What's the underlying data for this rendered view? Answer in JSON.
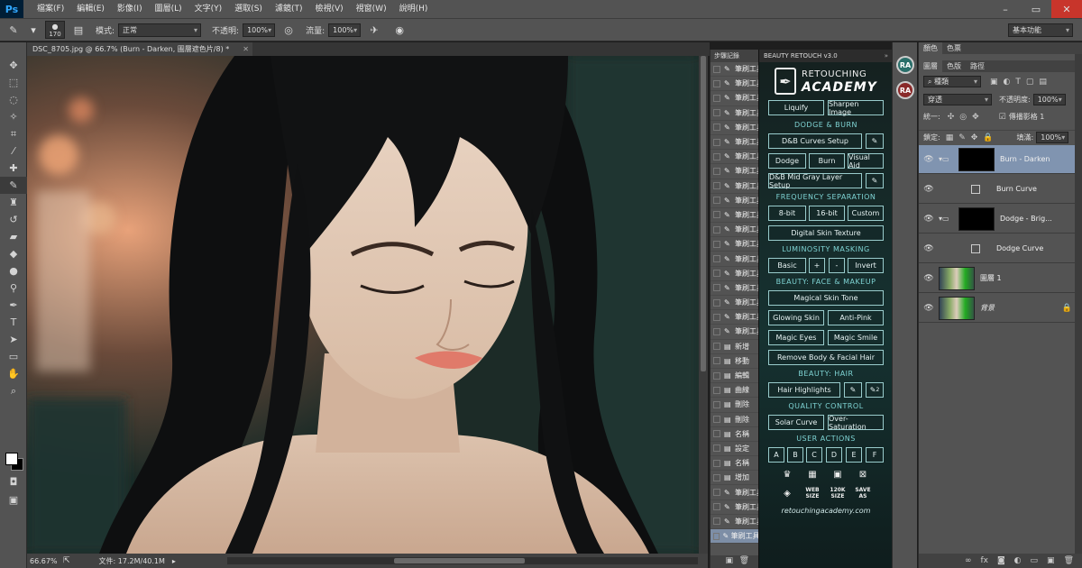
{
  "app": {
    "logo": "Ps",
    "menu": [
      "檔案(F)",
      "編輯(E)",
      "影像(I)",
      "圖層(L)",
      "文字(Y)",
      "選取(S)",
      "濾鏡(T)",
      "檢視(V)",
      "視窗(W)",
      "說明(H)"
    ]
  },
  "options": {
    "brush_size": "170",
    "mode_label": "模式:",
    "mode_value": "正常",
    "opacity_label": "不透明:",
    "opacity_value": "100%",
    "flow_label": "流量:",
    "flow_value": "100%",
    "workspace": "基本功能"
  },
  "document": {
    "tab_title": "DSC_8705.jpg @ 66.7% (Burn - Darken, 圖層遮色片/8) *",
    "zoom": "66.67%",
    "file_size": "文件: 17.2M/40.1M"
  },
  "history": {
    "tab": "步驟記錄",
    "items": [
      {
        "label": "筆刷工具",
        "type": "brush"
      },
      {
        "label": "筆刷工具",
        "type": "brush"
      },
      {
        "label": "筆刷工具",
        "type": "brush"
      },
      {
        "label": "筆刷工具",
        "type": "brush"
      },
      {
        "label": "筆刷工具",
        "type": "brush"
      },
      {
        "label": "筆刷工具",
        "type": "brush"
      },
      {
        "label": "筆刷工具",
        "type": "brush"
      },
      {
        "label": "筆刷工具",
        "type": "brush"
      },
      {
        "label": "筆刷工具",
        "type": "brush"
      },
      {
        "label": "筆刷工具",
        "type": "brush"
      },
      {
        "label": "筆刷工具",
        "type": "brush"
      },
      {
        "label": "筆刷工具",
        "type": "brush"
      },
      {
        "label": "筆刷工具",
        "type": "brush"
      },
      {
        "label": "筆刷工具",
        "type": "brush"
      },
      {
        "label": "筆刷工具",
        "type": "brush"
      },
      {
        "label": "筆刷工具",
        "type": "brush"
      },
      {
        "label": "筆刷工具",
        "type": "brush"
      },
      {
        "label": "筆刷工具",
        "type": "brush"
      },
      {
        "label": "筆刷工具",
        "type": "brush"
      },
      {
        "label": "新增",
        "type": "doc"
      },
      {
        "label": "移動",
        "type": "doc"
      },
      {
        "label": "編輯",
        "type": "doc"
      },
      {
        "label": "曲線",
        "type": "doc"
      },
      {
        "label": "刪除",
        "type": "doc"
      },
      {
        "label": "刪除",
        "type": "doc"
      },
      {
        "label": "名稱",
        "type": "doc"
      },
      {
        "label": "設定",
        "type": "doc"
      },
      {
        "label": "名稱",
        "type": "doc"
      },
      {
        "label": "增加",
        "type": "doc"
      },
      {
        "label": "筆刷工具",
        "type": "brush"
      },
      {
        "label": "筆刷工具",
        "type": "brush"
      },
      {
        "label": "筆刷工具",
        "type": "brush"
      },
      {
        "label": "筆刷工具",
        "type": "brush"
      }
    ]
  },
  "beauty": {
    "tab": "BEAUTY RETOUCH v3.0",
    "logo_line1": "RETOUCHING",
    "logo_line2": "ACADEMY",
    "liquify": "Liquify",
    "sharpen": "Sharpen Image",
    "h_dodge_burn": "DODGE & BURN",
    "db_curves": "D&B Curves Setup",
    "dodge": "Dodge",
    "burn": "Burn",
    "visual_aid": "Visual Aid",
    "db_mid_gray": "D&B Mid Gray Layer Setup",
    "h_freq": "FREQUENCY SEPARATION",
    "bit8": "8-bit",
    "bit16": "16-bit",
    "custom": "Custom",
    "digital_skin": "Digital Skin Texture",
    "h_lum": "LUMINOSITY MASKING",
    "basic": "Basic",
    "plus": "+",
    "minus": "-",
    "invert": "Invert",
    "h_face": "BEAUTY: FACE & MAKEUP",
    "magical_skin": "Magical Skin Tone",
    "glowing_skin": "Glowing Skin",
    "anti_pink": "Anti-Pink",
    "magic_eyes": "Magic Eyes",
    "magic_smile": "Magic Smile",
    "remove_hair": "Remove Body & Facial Hair",
    "h_hair": "BEAUTY: HAIR",
    "hair_highlights": "Hair Highlights",
    "brush2": "2",
    "h_qc": "QUALITY CONTROL",
    "solar_curve": "Solar Curve",
    "over_sat": "Over-Saturation",
    "h_user": "USER ACTIONS",
    "user_actions": [
      "A",
      "B",
      "C",
      "D",
      "E",
      "F"
    ],
    "web_size": "WEB SIZE",
    "size_120k": "120K SIZE",
    "save_as": "SAVE AS",
    "url": "retouchingacademy.com"
  },
  "dock": {
    "badge1": "RA",
    "badge2": "RA"
  },
  "panels": {
    "color_tabs": [
      "顏色",
      "色票"
    ],
    "layer_tabs": [
      "圖層",
      "色版",
      "路徑"
    ],
    "kind": "種類",
    "blend": "穿透",
    "opacity_label": "不透明度:",
    "opacity_value": "100%",
    "unify_label": "統一:",
    "propagate": "傳播影格 1",
    "lock_label": "鎖定:",
    "fill_label": "填滿:",
    "fill_value": "100%",
    "layers": [
      {
        "name": "Burn - Darken",
        "kind": "group"
      },
      {
        "name": "Burn Curve",
        "kind": "adjust"
      },
      {
        "name": "Dodge - Brig...",
        "kind": "group"
      },
      {
        "name": "Dodge Curve",
        "kind": "adjust"
      },
      {
        "name": "圖層 1",
        "kind": "photo"
      },
      {
        "name": "背景",
        "kind": "photo"
      }
    ]
  }
}
